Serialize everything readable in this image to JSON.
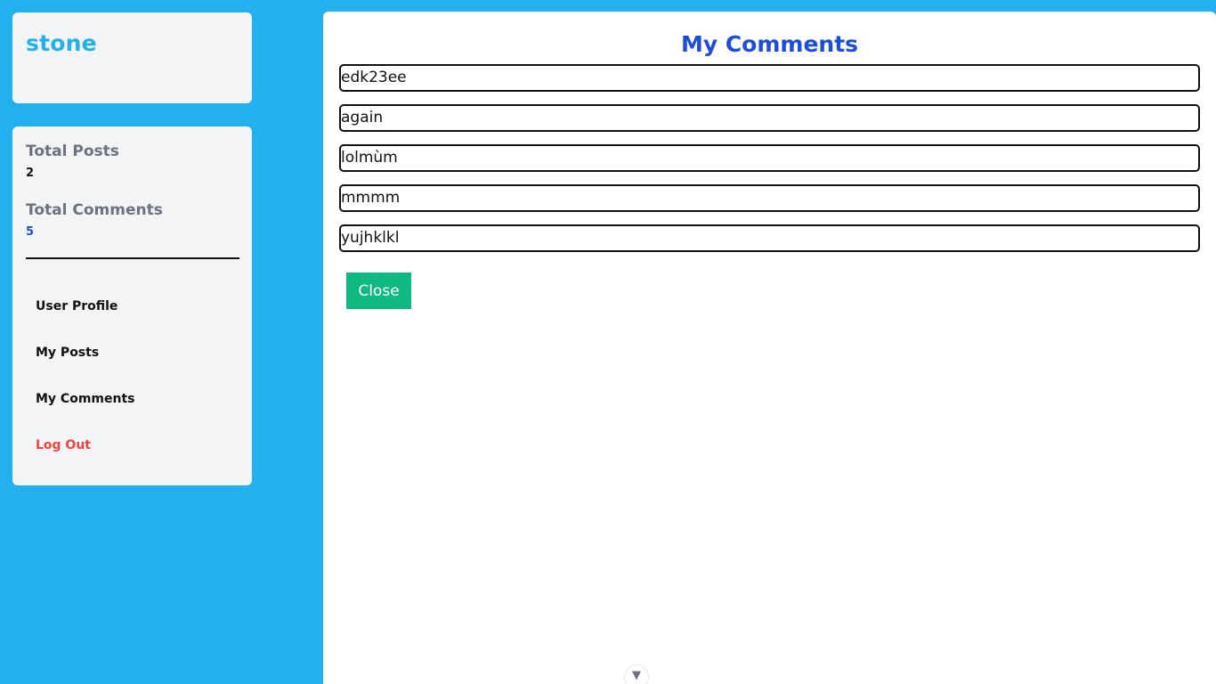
{
  "user": {
    "username": "stone"
  },
  "stats": {
    "total_posts_label": "Total Posts",
    "total_posts_value": "2",
    "total_comments_label": "Total Comments",
    "total_comments_value": "5"
  },
  "nav": {
    "items": [
      {
        "label": "User Profile"
      },
      {
        "label": "My Posts"
      },
      {
        "label": "My Comments"
      },
      {
        "label": "Log Out"
      }
    ]
  },
  "main": {
    "title": "My Comments",
    "comments": [
      "edk23ee",
      "again",
      "lolmùm",
      "mmmm",
      "yujhklkl"
    ],
    "close_label": "Close"
  },
  "scroll_indicator": {
    "icon": "chevron-down-icon",
    "glyph": "▼"
  },
  "colors": {
    "background": "#22b0ef",
    "accent_blue": "#1d4ed8",
    "close_green": "#10b981",
    "logout_red": "#ef4444"
  }
}
